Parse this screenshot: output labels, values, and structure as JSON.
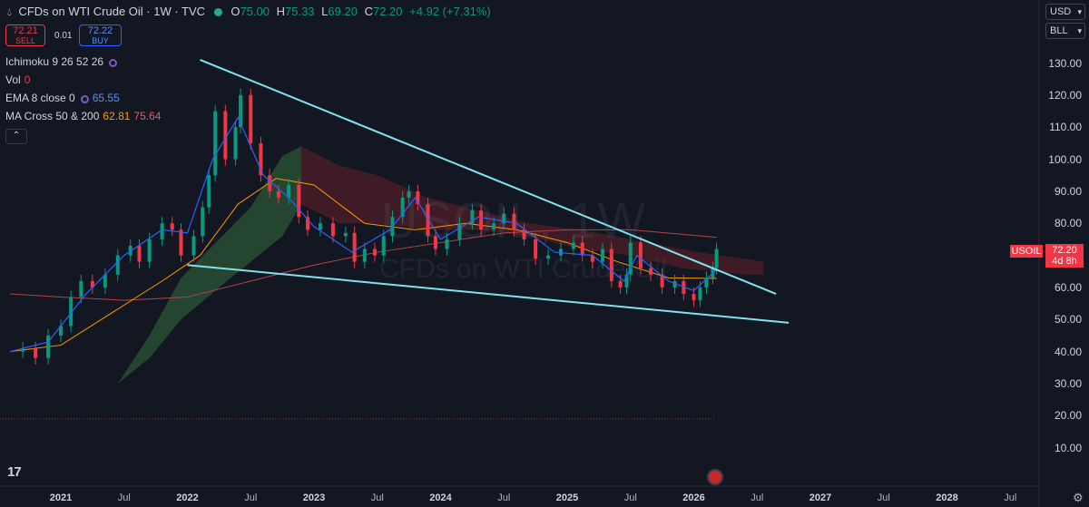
{
  "header": {
    "title": "CFDs on WTI Crude Oil · 1W · TVC",
    "open_label": "O",
    "open": "75.00",
    "high_label": "H",
    "high": "75.33",
    "low_label": "L",
    "low": "69.20",
    "close_label": "C",
    "close": "72.20",
    "change": "+4.92 (+7.31%)"
  },
  "trade": {
    "sell_price": "72.21",
    "sell_label": "SELL",
    "spread": "0.01",
    "buy_price": "72.22",
    "buy_label": "BUY"
  },
  "indicators": [
    {
      "name": "Ichimoku 9 26 52 26",
      "values": []
    },
    {
      "name": "Vol",
      "values": [
        "0"
      ]
    },
    {
      "name": "EMA 8 close 0",
      "values": [
        "65.55"
      ]
    },
    {
      "name": "MA Cross 50 & 200",
      "values": [
        "62.81",
        "75.64"
      ]
    }
  ],
  "controls": {
    "currency": "USD",
    "unit": "BLL",
    "collapse_icon": "chevron-up-icon"
  },
  "price_tag": {
    "symbol": "USOIL",
    "price": "72.20",
    "countdown": "4d 8h"
  },
  "watermark": {
    "symbol": "USOIL, 1W",
    "description": "CFDs on WTI Crude Oil"
  },
  "colors": {
    "background": "#131722",
    "up": "#089981",
    "down": "#f23645",
    "trendline": "#7fe3ee",
    "ema": "#2962ff"
  },
  "chart_data": {
    "type": "line",
    "title": "CFDs on WTI Crude Oil · 1W · TVC",
    "xlabel": "",
    "ylabel": "",
    "ylim": [
      5,
      135
    ],
    "y_ticks": [
      "130.00",
      "120.00",
      "110.00",
      "100.00",
      "90.00",
      "80.00",
      "70.00",
      "60.00",
      "50.00",
      "40.00",
      "30.00",
      "20.00",
      "10.00"
    ],
    "x_ticks": [
      "2021",
      "Jul",
      "2022",
      "Jul",
      "2023",
      "Jul",
      "2024",
      "Jul",
      "2025",
      "Jul",
      "2026",
      "Jul",
      "2027",
      "Jul",
      "2028",
      "Jul"
    ],
    "x_tick_dates": [
      2021.0,
      2021.5,
      2022.0,
      2022.5,
      2023.0,
      2023.5,
      2024.0,
      2024.5,
      2025.0,
      2025.5,
      2026.0,
      2026.5,
      2027.0,
      2027.5,
      2028.0,
      2028.5
    ],
    "series": [
      {
        "name": "",
        "type": "weekly close",
        "x": [
          2020.6,
          2020.7,
          2020.8,
          2020.9,
          2021.0,
          2021.08,
          2021.16,
          2021.25,
          2021.35,
          2021.45,
          2021.55,
          2021.62,
          2021.7,
          2021.8,
          2021.88,
          2021.95,
          2022.05,
          2022.12,
          2022.17,
          2022.22,
          2022.3,
          2022.38,
          2022.42,
          2022.5,
          2022.58,
          2022.65,
          2022.72,
          2022.8,
          2022.88,
          2022.95,
          2023.05,
          2023.15,
          2023.25,
          2023.32,
          2023.4,
          2023.48,
          2023.55,
          2023.62,
          2023.7,
          2023.75,
          2023.82,
          2023.9,
          2023.96,
          2024.05,
          2024.15,
          2024.25,
          2024.32,
          2024.42,
          2024.5,
          2024.58,
          2024.66,
          2024.75,
          2024.85,
          2024.95,
          2025.05,
          2025.12,
          2025.2,
          2025.28,
          2025.35,
          2025.42,
          2025.47,
          2025.5,
          2025.58,
          2025.66,
          2025.75,
          2025.85,
          2025.92,
          2026.0,
          2026.05,
          2026.1,
          2026.15,
          2026.18
        ],
        "y": [
          40,
          41,
          38,
          45,
          48,
          57,
          62,
          60,
          64,
          70,
          73,
          68,
          75,
          80,
          78,
          70,
          76,
          85,
          95,
          115,
          100,
          110,
          120,
          105,
          95,
          90,
          88,
          92,
          82,
          78,
          80,
          76,
          77,
          68,
          72,
          70,
          76,
          82,
          88,
          90,
          86,
          76,
          72,
          75,
          80,
          84,
          78,
          80,
          83,
          78,
          75,
          69,
          70,
          72,
          74,
          70,
          68,
          72,
          62,
          60,
          64,
          74,
          66,
          64,
          60,
          62,
          58,
          56,
          60,
          63,
          66,
          72
        ]
      },
      {
        "name": "",
        "type": "EMA 8",
        "color": "#2962ff",
        "x": [
          2020.6,
          2020.9,
          2021.2,
          2021.5,
          2021.8,
          2022.0,
          2022.2,
          2022.4,
          2022.6,
          2022.8,
          2023.0,
          2023.3,
          2023.6,
          2023.8,
          2024.0,
          2024.3,
          2024.6,
          2024.9,
          2025.2,
          2025.45,
          2025.55,
          2025.8,
          2026.0,
          2026.18
        ],
        "y": [
          40,
          43,
          58,
          70,
          78,
          77,
          100,
          113,
          95,
          88,
          79,
          71,
          78,
          88,
          75,
          82,
          80,
          71,
          70,
          62,
          70,
          62,
          59,
          65.55
        ]
      },
      {
        "name": "",
        "type": "MA 50",
        "color": "#ff9800",
        "x": [
          2020.6,
          2021.0,
          2021.4,
          2021.8,
          2022.1,
          2022.4,
          2022.7,
          2023.0,
          2023.4,
          2023.8,
          2024.2,
          2024.6,
          2025.0,
          2025.4,
          2025.8,
          2026.18
        ],
        "y": [
          40,
          42,
          52,
          62,
          70,
          86,
          94,
          92,
          80,
          78,
          80,
          78,
          74,
          68,
          63,
          62.81
        ]
      },
      {
        "name": "",
        "type": "MA 200",
        "color": "#ef5350",
        "x": [
          2020.6,
          2021.0,
          2021.5,
          2022.0,
          2022.5,
          2023.0,
          2023.5,
          2024.0,
          2024.5,
          2025.0,
          2025.5,
          2026.18
        ],
        "y": [
          58,
          57,
          56,
          57,
          62,
          67,
          71,
          74,
          77,
          78,
          78,
          75.64
        ]
      },
      {
        "name": "",
        "type": "trendline upper",
        "color": "#7fe3ee",
        "x": [
          2022.1,
          2026.65
        ],
        "y": [
          131.0,
          58.0
        ]
      },
      {
        "name": "",
        "type": "trendline lower",
        "color": "#7fe3ee",
        "x": [
          2022.0,
          2026.75
        ],
        "y": [
          67.0,
          49.0
        ]
      },
      {
        "name": "",
        "type": "ichimoku cloud upper",
        "x": [
          2021.45,
          2021.7,
          2021.95,
          2022.25,
          2022.5,
          2022.75,
          2022.9,
          2023.2,
          2023.5,
          2023.9,
          2024.3,
          2024.7,
          2025.1,
          2025.5,
          2025.9,
          2026.2,
          2026.4,
          2026.55
        ],
        "y": [
          30,
          45,
          63,
          75,
          85,
          101,
          104,
          98,
          95,
          88,
          84,
          80,
          78,
          75,
          72,
          70,
          69,
          68
        ]
      },
      {
        "name": "",
        "type": "ichimoku cloud lower",
        "x": [
          2021.45,
          2021.7,
          2021.95,
          2022.25,
          2022.5,
          2022.75,
          2022.9,
          2023.2,
          2023.5,
          2023.9,
          2024.3,
          2024.7,
          2025.1,
          2025.5,
          2025.9,
          2026.2,
          2026.4,
          2026.55
        ],
        "y": [
          30,
          38,
          50,
          60,
          68,
          76,
          86,
          80,
          80,
          78,
          78,
          76,
          72,
          70,
          66,
          65,
          64,
          64
        ]
      }
    ]
  }
}
